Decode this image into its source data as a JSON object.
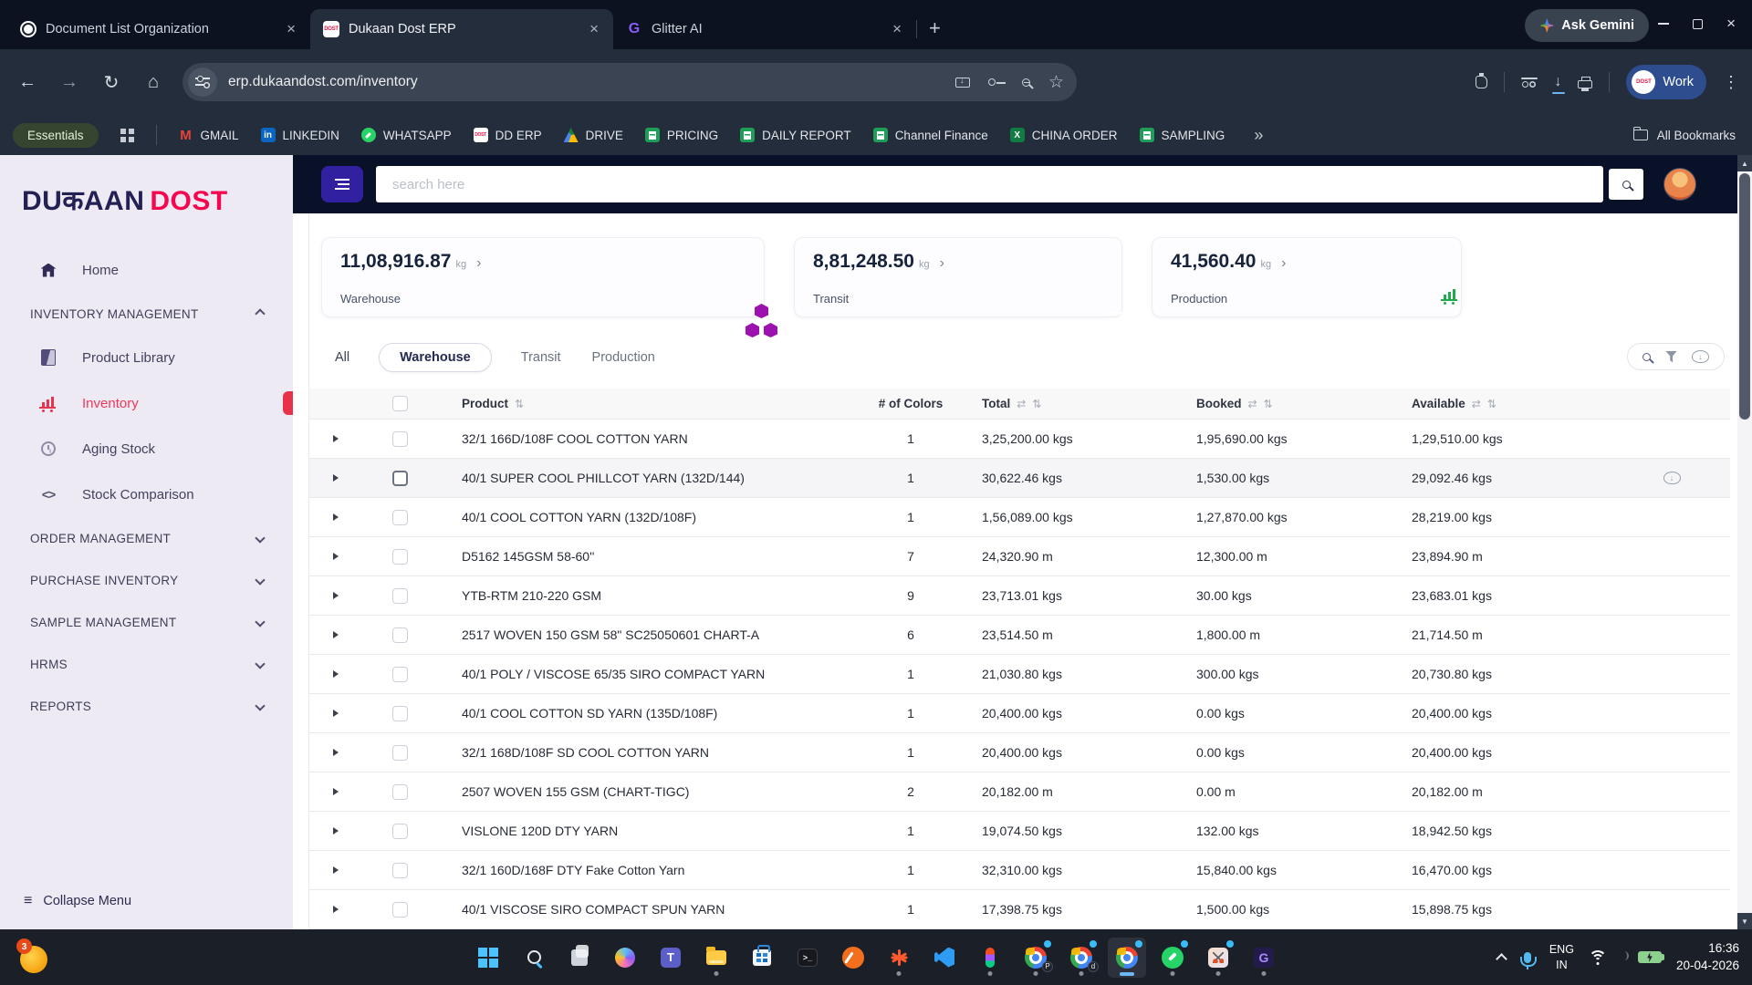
{
  "browser": {
    "tabs": [
      {
        "title": "Document List Organization",
        "icon": "chatgpt",
        "active": false
      },
      {
        "title": "Dukaan Dost ERP",
        "icon": "dost",
        "active": true
      },
      {
        "title": "Glitter AI",
        "icon": "glitter",
        "active": false
      }
    ],
    "new_tab_label": "+",
    "gemini_label": "Ask Gemini",
    "url": "erp.dukaandost.com/inventory",
    "profile_label": "Work",
    "profile_logo_text": "DOST",
    "bookmarks_group": "Essentials",
    "bookmarks": [
      {
        "label": "GMAIL",
        "icon": "gmail"
      },
      {
        "label": "LINKEDIN",
        "icon": "linkedin"
      },
      {
        "label": "WHATSAPP",
        "icon": "whatsapp"
      },
      {
        "label": "DD ERP",
        "icon": "dost"
      },
      {
        "label": "DRIVE",
        "icon": "drive"
      },
      {
        "label": "PRICING",
        "icon": "sheets"
      },
      {
        "label": "DAILY REPORT",
        "icon": "sheets"
      },
      {
        "label": "Channel Finance",
        "icon": "sheets"
      },
      {
        "label": "CHINA ORDER",
        "icon": "excel"
      },
      {
        "label": "SAMPLING",
        "icon": "sheets"
      }
    ],
    "bookmarks_overflow": "»",
    "all_bookmarks_label": "All Bookmarks"
  },
  "sidebar": {
    "logo_part1": "DUकAAN",
    "logo_part2": "DOST",
    "items": [
      {
        "type": "item",
        "icon": "home",
        "label": "Home"
      },
      {
        "type": "section",
        "label": "INVENTORY MANAGEMENT",
        "chevron": "up"
      },
      {
        "type": "item",
        "icon": "book",
        "label": "Product Library"
      },
      {
        "type": "item",
        "icon": "cart",
        "label": "Inventory",
        "active": true,
        "badge": true
      },
      {
        "type": "item",
        "icon": "clock",
        "label": "Aging Stock"
      },
      {
        "type": "item",
        "icon": "code",
        "label": "Stock Comparison"
      },
      {
        "type": "section",
        "label": "ORDER MANAGEMENT",
        "chevron": "down"
      },
      {
        "type": "section",
        "label": "PURCHASE INVENTORY",
        "chevron": "down"
      },
      {
        "type": "section",
        "label": "SAMPLE MANAGEMENT",
        "chevron": "down"
      },
      {
        "type": "section",
        "label": "HRMS",
        "chevron": "down"
      },
      {
        "type": "section",
        "label": "REPORTS",
        "chevron": "down"
      }
    ],
    "collapse_label": "Collapse Menu"
  },
  "header": {
    "search_placeholder": "search here"
  },
  "cards": [
    {
      "value": "11,08,916.87",
      "unit": "kg",
      "arrow": "›",
      "label": "Warehouse",
      "icon": "boxes",
      "color": "#9c12ae"
    },
    {
      "value": "8,81,248.50",
      "unit": "kg",
      "arrow": "›",
      "label": "Transit",
      "icon": "scroll",
      "color": "#5e9bf8"
    },
    {
      "value": "41,560.40",
      "unit": "kg",
      "arrow": "›",
      "label": "Production",
      "icon": "cart",
      "color": "#1faa4f"
    }
  ],
  "view_tabs": [
    {
      "label": "All",
      "selected": false
    },
    {
      "label": "Warehouse",
      "selected": true
    },
    {
      "label": "Transit",
      "selected": false
    },
    {
      "label": "Production",
      "selected": false
    }
  ],
  "table": {
    "columns": [
      "Product",
      "# of Colors",
      "Total",
      "Booked",
      "Available"
    ],
    "sort_glyph": "⇅",
    "swap_glyph": "⇄",
    "rows": [
      {
        "product": "32/1 166D/108F COOL COTTON YARN",
        "colors": "1",
        "total": "3,25,200.00 kgs",
        "booked": "1,95,690.00 kgs",
        "available": "1,29,510.00 kgs",
        "selected": false,
        "cloud": false
      },
      {
        "product": "40/1 SUPER COOL PHILLCOT YARN (132D/144)",
        "colors": "1",
        "total": "30,622.46 kgs",
        "booked": "1,530.00 kgs",
        "available": "29,092.46 kgs",
        "selected": true,
        "cloud": true
      },
      {
        "product": "40/1 COOL COTTON YARN (132D/108F)",
        "colors": "1",
        "total": "1,56,089.00 kgs",
        "booked": "1,27,870.00 kgs",
        "available": "28,219.00 kgs",
        "selected": false,
        "cloud": false
      },
      {
        "product": "D5162 145GSM 58-60''",
        "colors": "7",
        "total": "24,320.90 m",
        "booked": "12,300.00 m",
        "available": "23,894.90 m",
        "selected": false,
        "cloud": false
      },
      {
        "product": "YTB-RTM 210-220 GSM",
        "colors": "9",
        "total": "23,713.01 kgs",
        "booked": "30.00 kgs",
        "available": "23,683.01 kgs",
        "selected": false,
        "cloud": false
      },
      {
        "product": "2517 WOVEN 150 GSM 58\" SC25050601 CHART-A",
        "colors": "6",
        "total": "23,514.50 m",
        "booked": "1,800.00 m",
        "available": "21,714.50 m",
        "selected": false,
        "cloud": false
      },
      {
        "product": "40/1 POLY / VISCOSE 65/35 SIRO COMPACT YARN",
        "colors": "1",
        "total": "21,030.80 kgs",
        "booked": "300.00 kgs",
        "available": "20,730.80 kgs",
        "selected": false,
        "cloud": false
      },
      {
        "product": "40/1 COOL COTTON SD YARN (135D/108F)",
        "colors": "1",
        "total": "20,400.00 kgs",
        "booked": "0.00 kgs",
        "available": "20,400.00 kgs",
        "selected": false,
        "cloud": false
      },
      {
        "product": "32/1 168D/108F SD COOL COTTON YARN",
        "colors": "1",
        "total": "20,400.00 kgs",
        "booked": "0.00 kgs",
        "available": "20,400.00 kgs",
        "selected": false,
        "cloud": false
      },
      {
        "product": "2507 WOVEN 155 GSM (CHART-TIGC)",
        "colors": "2",
        "total": "20,182.00 m",
        "booked": "0.00 m",
        "available": "20,182.00 m",
        "selected": false,
        "cloud": false
      },
      {
        "product": "VISLONE 120D DTY YARN",
        "colors": "1",
        "total": "19,074.50 kgs",
        "booked": "132.00 kgs",
        "available": "18,942.50 kgs",
        "selected": false,
        "cloud": false
      },
      {
        "product": "32/1 160D/168F DTY Fake Cotton Yarn",
        "colors": "1",
        "total": "32,310.00 kgs",
        "booked": "15,840.00 kgs",
        "available": "16,470.00 kgs",
        "selected": false,
        "cloud": false
      },
      {
        "product": "40/1 VISCOSE SIRO COMPACT SPUN YARN",
        "colors": "1",
        "total": "17,398.75 kgs",
        "booked": "1,500.00 kgs",
        "available": "15,898.75 kgs",
        "selected": false,
        "cloud": false
      }
    ]
  },
  "taskbar": {
    "widgets_badge": "3",
    "icons": [
      {
        "name": "start",
        "cls": "ti-start",
        "dot": false,
        "badge": false
      },
      {
        "name": "search",
        "cls": "ti-search",
        "dot": false,
        "badge": false
      },
      {
        "name": "task-view",
        "cls": "ti-taskview",
        "dot": false,
        "badge": false
      },
      {
        "name": "copilot",
        "cls": "ti-copilot",
        "dot": false,
        "badge": false
      },
      {
        "name": "teams",
        "cls": "ti-teams",
        "dot": false,
        "badge": false,
        "letter": "T"
      },
      {
        "name": "file-explorer",
        "cls": "ti-explorer",
        "dot": true,
        "badge": false
      },
      {
        "name": "ms-store",
        "cls": "ti-store",
        "dot": false,
        "badge": false
      },
      {
        "name": "terminal",
        "cls": "ti-terminal",
        "dot": false,
        "badge": false,
        "letter": ">_"
      },
      {
        "name": "capture-app",
        "cls": "ti-orange",
        "dot": false,
        "badge": false
      },
      {
        "name": "starburst-app",
        "cls": "ti-burst",
        "dot": true,
        "badge": false
      },
      {
        "name": "vscode",
        "cls": "ti-vscode",
        "dot": false,
        "badge": false
      },
      {
        "name": "figma",
        "cls": "ti-figma",
        "dot": true,
        "badge": false
      },
      {
        "name": "chrome-profile-1",
        "cls": "ti-chrome",
        "dot": true,
        "badge": true,
        "profile": "P"
      },
      {
        "name": "chrome-profile-2",
        "cls": "ti-chrome",
        "dot": true,
        "badge": true,
        "profile": "d"
      },
      {
        "name": "chrome-active",
        "cls": "ti-chrome",
        "dot": true,
        "badge": true,
        "active": true
      },
      {
        "name": "whatsapp",
        "cls": "ti-wa",
        "dot": true,
        "badge": true
      },
      {
        "name": "snipping-tool",
        "cls": "ti-snip",
        "dot": true,
        "badge": true
      },
      {
        "name": "glitter-app",
        "cls": "ti-glitter",
        "dot": true,
        "badge": false,
        "letter": "G"
      }
    ],
    "tray": {
      "lang_line1": "ENG",
      "lang_line2": "IN",
      "time": "16:36",
      "date": "20-04-2026"
    }
  }
}
